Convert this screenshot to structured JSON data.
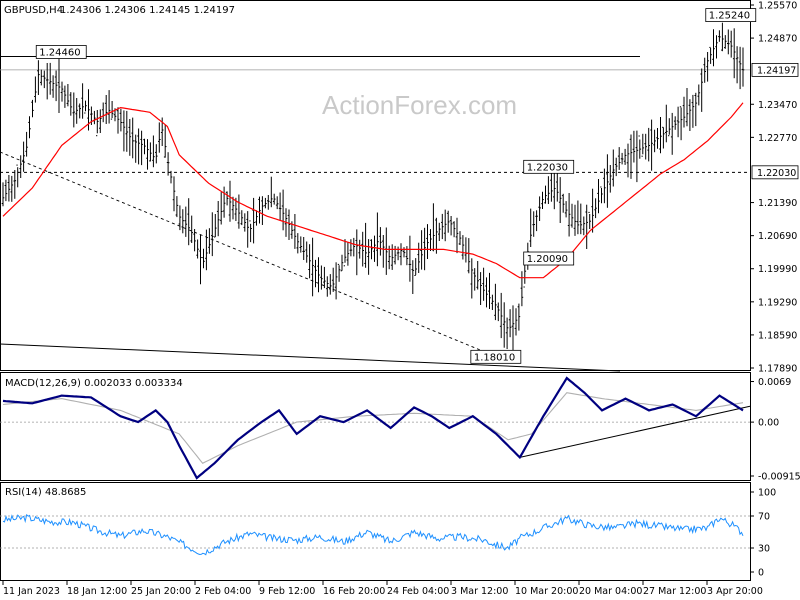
{
  "header": {
    "symbol": "GBPUSD,H4",
    "ohlc": "1.24306 1.24306 1.24145 1.24197"
  },
  "watermark": "ActionForex.com",
  "colors": {
    "price": "#000000",
    "ma": "#ff0000",
    "macd": "#000080",
    "signal": "#b0b0b0",
    "rsi": "#1e90ff",
    "level": "#000000"
  },
  "chart_data": [
    {
      "type": "line",
      "name": "price",
      "y_ticks": [
        "1.25570",
        "1.24870",
        "1.24197",
        "1.23470",
        "1.22770",
        "1.22030",
        "1.21390",
        "1.20690",
        "1.19990",
        "1.19290",
        "1.18590",
        "1.17890"
      ],
      "ylim": [
        1.1789,
        1.2557
      ],
      "x_ticks": [
        "11 Jan 2023",
        "18 Jan 12:00",
        "25 Jan 20:00",
        "2 Feb 04:00",
        "9 Feb 12:00",
        "16 Feb 20:00",
        "24 Feb 04:00",
        "3 Mar 12:00",
        "10 Mar 20:00",
        "20 Mar 04:00",
        "27 Mar 12:00",
        "3 Apr 20:00"
      ],
      "current_price": "1.24197",
      "resistance_price": "1.22030",
      "labels": [
        {
          "text": "1.24460",
          "x": 6,
          "y": 1.2446
        },
        {
          "text": "1.25240",
          "x": 120,
          "y": 1.2524
        },
        {
          "text": "1.22030",
          "x": 89,
          "y": 1.2203
        },
        {
          "text": "1.20090",
          "x": 89,
          "y": 1.2009
        },
        {
          "text": "1.18010",
          "x": 80,
          "y": 1.1801
        }
      ],
      "close_points": [
        [
          0,
          1.2149
        ],
        [
          2,
          1.2185
        ],
        [
          4,
          1.2255
        ],
        [
          6,
          1.241
        ],
        [
          8,
          1.2395
        ],
        [
          10,
          1.238
        ],
        [
          12,
          1.233
        ],
        [
          14,
          1.2345
        ],
        [
          16,
          1.231
        ],
        [
          18,
          1.2335
        ],
        [
          20,
          1.231
        ],
        [
          22,
          1.227
        ],
        [
          24,
          1.226
        ],
        [
          26,
          1.223
        ],
        [
          27,
          1.23
        ],
        [
          28,
          1.223
        ],
        [
          30,
          1.211
        ],
        [
          32,
          1.208
        ],
        [
          34,
          1.201
        ],
        [
          36,
          1.208
        ],
        [
          38,
          1.215
        ],
        [
          40,
          1.212
        ],
        [
          42,
          1.208
        ],
        [
          44,
          1.213
        ],
        [
          46,
          1.215
        ],
        [
          48,
          1.211
        ],
        [
          50,
          1.206
        ],
        [
          52,
          1.202
        ],
        [
          54,
          1.198
        ],
        [
          56,
          1.196
        ],
        [
          58,
          1.202
        ],
        [
          60,
          1.205
        ],
        [
          62,
          1.203
        ],
        [
          64,
          1.206
        ],
        [
          66,
          1.202
        ],
        [
          68,
          1.204
        ],
        [
          70,
          1.199
        ],
        [
          72,
          1.205
        ],
        [
          74,
          1.208
        ],
        [
          76,
          1.21
        ],
        [
          78,
          1.206
        ],
        [
          80,
          1.199
        ],
        [
          82,
          1.195
        ],
        [
          84,
          1.192
        ],
        [
          86,
          1.187
        ],
        [
          88,
          1.19
        ],
        [
          89,
          1.201
        ],
        [
          90,
          1.208
        ],
        [
          92,
          1.215
        ],
        [
          94,
          1.217
        ],
        [
          96,
          1.212
        ],
        [
          98,
          1.209
        ],
        [
          100,
          1.21
        ],
        [
          102,
          1.216
        ],
        [
          104,
          1.221
        ],
        [
          106,
          1.224
        ],
        [
          108,
          1.225
        ],
        [
          110,
          1.226
        ],
        [
          112,
          1.228
        ],
        [
          114,
          1.23
        ],
        [
          116,
          1.232
        ],
        [
          118,
          1.235
        ],
        [
          120,
          1.244
        ],
        [
          122,
          1.249
        ],
        [
          124,
          1.247
        ],
        [
          126,
          1.242
        ]
      ],
      "ma_points": [
        [
          0,
          1.211
        ],
        [
          5,
          1.217
        ],
        [
          10,
          1.226
        ],
        [
          15,
          1.231
        ],
        [
          20,
          1.234
        ],
        [
          25,
          1.233
        ],
        [
          28,
          1.23
        ],
        [
          30,
          1.224
        ],
        [
          35,
          1.218
        ],
        [
          40,
          1.214
        ],
        [
          45,
          1.211
        ],
        [
          50,
          1.209
        ],
        [
          55,
          1.207
        ],
        [
          60,
          1.205
        ],
        [
          65,
          1.204
        ],
        [
          70,
          1.204
        ],
        [
          75,
          1.204
        ],
        [
          80,
          1.203
        ],
        [
          84,
          1.201
        ],
        [
          88,
          1.198
        ],
        [
          92,
          1.198
        ],
        [
          96,
          1.202
        ],
        [
          100,
          1.208
        ],
        [
          104,
          1.212
        ],
        [
          108,
          1.216
        ],
        [
          112,
          1.22
        ],
        [
          116,
          1.223
        ],
        [
          120,
          1.227
        ],
        [
          124,
          1.232
        ],
        [
          126,
          1.235
        ]
      ]
    },
    {
      "type": "line",
      "name": "MACD(12,26,9) 0.002033 0.003334",
      "y_ticks": [
        "0.0069",
        "0.00",
        "-0.009158"
      ],
      "ylim": [
        -0.0095,
        0.0075
      ],
      "macd_points": [
        [
          0,
          0.0036
        ],
        [
          5,
          0.0032
        ],
        [
          10,
          0.0045
        ],
        [
          15,
          0.0042
        ],
        [
          20,
          0.001
        ],
        [
          23,
          0.0
        ],
        [
          26,
          0.002
        ],
        [
          28,
          0.0
        ],
        [
          30,
          -0.004
        ],
        [
          33,
          -0.0095
        ],
        [
          36,
          -0.007
        ],
        [
          40,
          -0.003
        ],
        [
          44,
          0.0
        ],
        [
          47,
          0.002
        ],
        [
          50,
          -0.002
        ],
        [
          54,
          0.001
        ],
        [
          58,
          0.0
        ],
        [
          62,
          0.002
        ],
        [
          66,
          -0.001
        ],
        [
          70,
          0.0025
        ],
        [
          73,
          0.001
        ],
        [
          76,
          -0.001
        ],
        [
          80,
          0.001
        ],
        [
          84,
          -0.002
        ],
        [
          88,
          -0.006
        ],
        [
          92,
          0.001
        ],
        [
          96,
          0.0075
        ],
        [
          99,
          0.005
        ],
        [
          102,
          0.002
        ],
        [
          106,
          0.004
        ],
        [
          110,
          0.002
        ],
        [
          114,
          0.003
        ],
        [
          118,
          0.001
        ],
        [
          122,
          0.0045
        ],
        [
          126,
          0.002
        ]
      ],
      "signal_points": [
        [
          0,
          0.003
        ],
        [
          10,
          0.004
        ],
        [
          20,
          0.002
        ],
        [
          30,
          -0.002
        ],
        [
          34,
          -0.007
        ],
        [
          40,
          -0.004
        ],
        [
          50,
          0.0
        ],
        [
          60,
          0.001
        ],
        [
          70,
          0.0015
        ],
        [
          80,
          0.001
        ],
        [
          86,
          -0.003
        ],
        [
          90,
          -0.002
        ],
        [
          96,
          0.005
        ],
        [
          102,
          0.004
        ],
        [
          110,
          0.003
        ],
        [
          118,
          0.002
        ],
        [
          126,
          0.0033
        ]
      ]
    },
    {
      "type": "line",
      "name": "RSI(14) 48.8685",
      "y_ticks": [
        "100",
        "70",
        "30",
        "0"
      ],
      "ylim": [
        0,
        100
      ],
      "rsi_points": [
        [
          0,
          65
        ],
        [
          4,
          68
        ],
        [
          8,
          63
        ],
        [
          12,
          62
        ],
        [
          16,
          52
        ],
        [
          20,
          45
        ],
        [
          24,
          52
        ],
        [
          28,
          44
        ],
        [
          32,
          30
        ],
        [
          34,
          24
        ],
        [
          38,
          38
        ],
        [
          42,
          48
        ],
        [
          46,
          42
        ],
        [
          50,
          40
        ],
        [
          54,
          44
        ],
        [
          58,
          38
        ],
        [
          62,
          50
        ],
        [
          66,
          38
        ],
        [
          70,
          50
        ],
        [
          74,
          42
        ],
        [
          78,
          44
        ],
        [
          82,
          40
        ],
        [
          84,
          34
        ],
        [
          86,
          30
        ],
        [
          88,
          42
        ],
        [
          92,
          55
        ],
        [
          96,
          67
        ],
        [
          100,
          58
        ],
        [
          104,
          55
        ],
        [
          108,
          61
        ],
        [
          112,
          57
        ],
        [
          116,
          53
        ],
        [
          120,
          55
        ],
        [
          122,
          68
        ],
        [
          124,
          60
        ],
        [
          126,
          49
        ]
      ]
    }
  ]
}
